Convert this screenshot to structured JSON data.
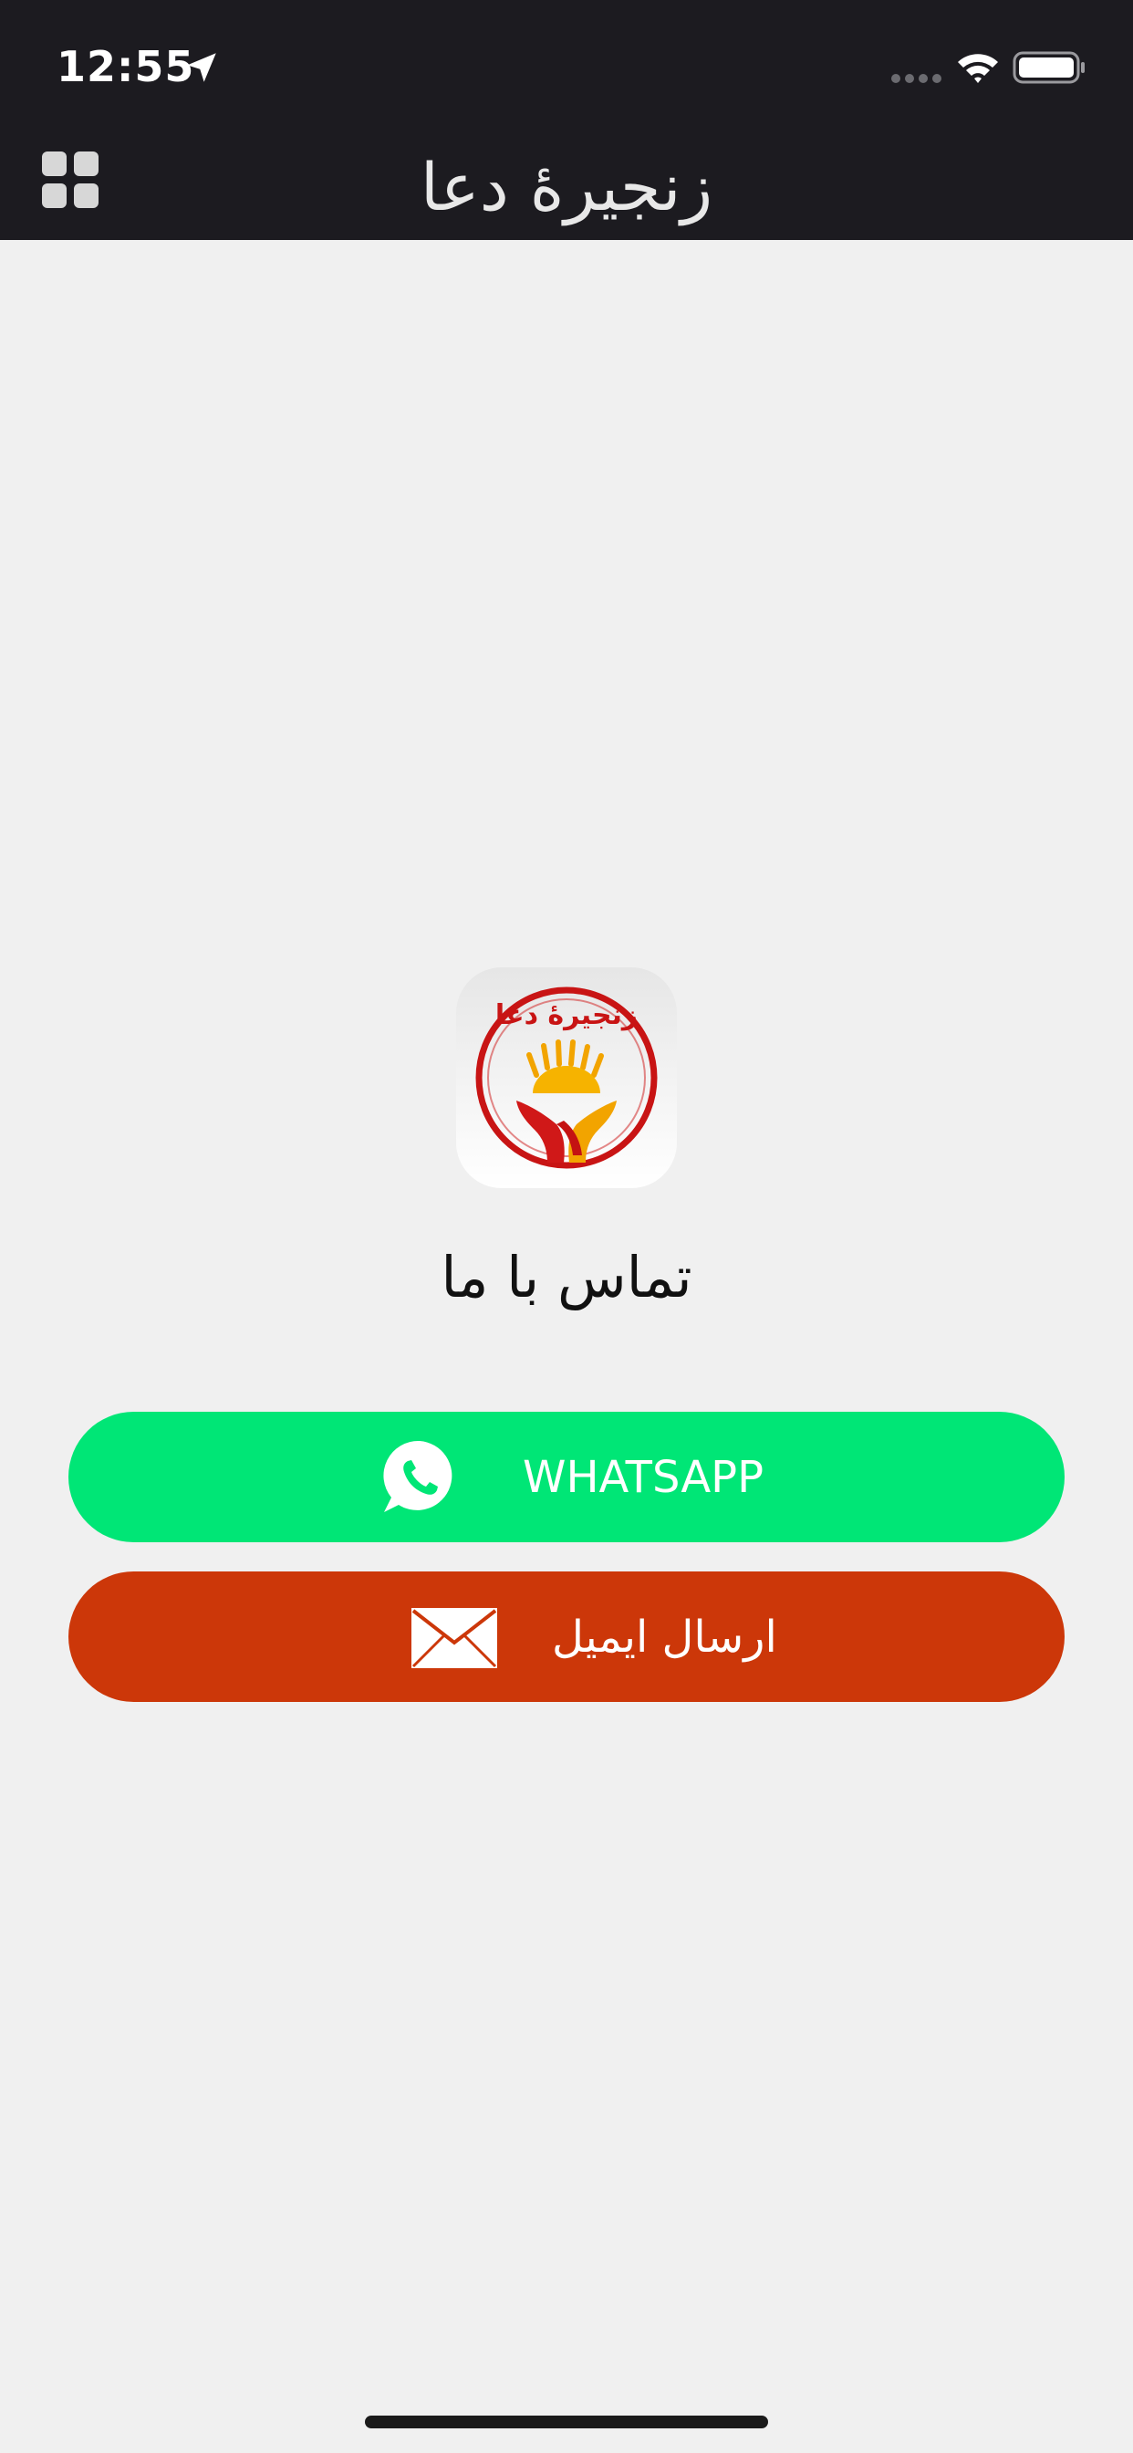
{
  "status_bar": {
    "time": "12:55"
  },
  "header": {
    "title": "زنجیرهٔ دعا"
  },
  "logo": {
    "text": "زنجیرهٔ دعا"
  },
  "contact": {
    "title": "تماس با ما"
  },
  "buttons": {
    "whatsapp_label": "WHATSAPP",
    "email_label": "ارسال ایمیل"
  },
  "colors": {
    "header_bg": "#1c1b20",
    "page_bg": "#f0f0f0",
    "whatsapp_green": "#00e676",
    "email_red": "#cc3709"
  },
  "icons": {
    "location": "location-arrow-icon",
    "signal": "cellular-signal-icon",
    "wifi": "wifi-icon",
    "battery": "battery-icon",
    "menu": "grid-menu-icon",
    "whatsapp": "whatsapp-icon",
    "email": "envelope-icon"
  }
}
